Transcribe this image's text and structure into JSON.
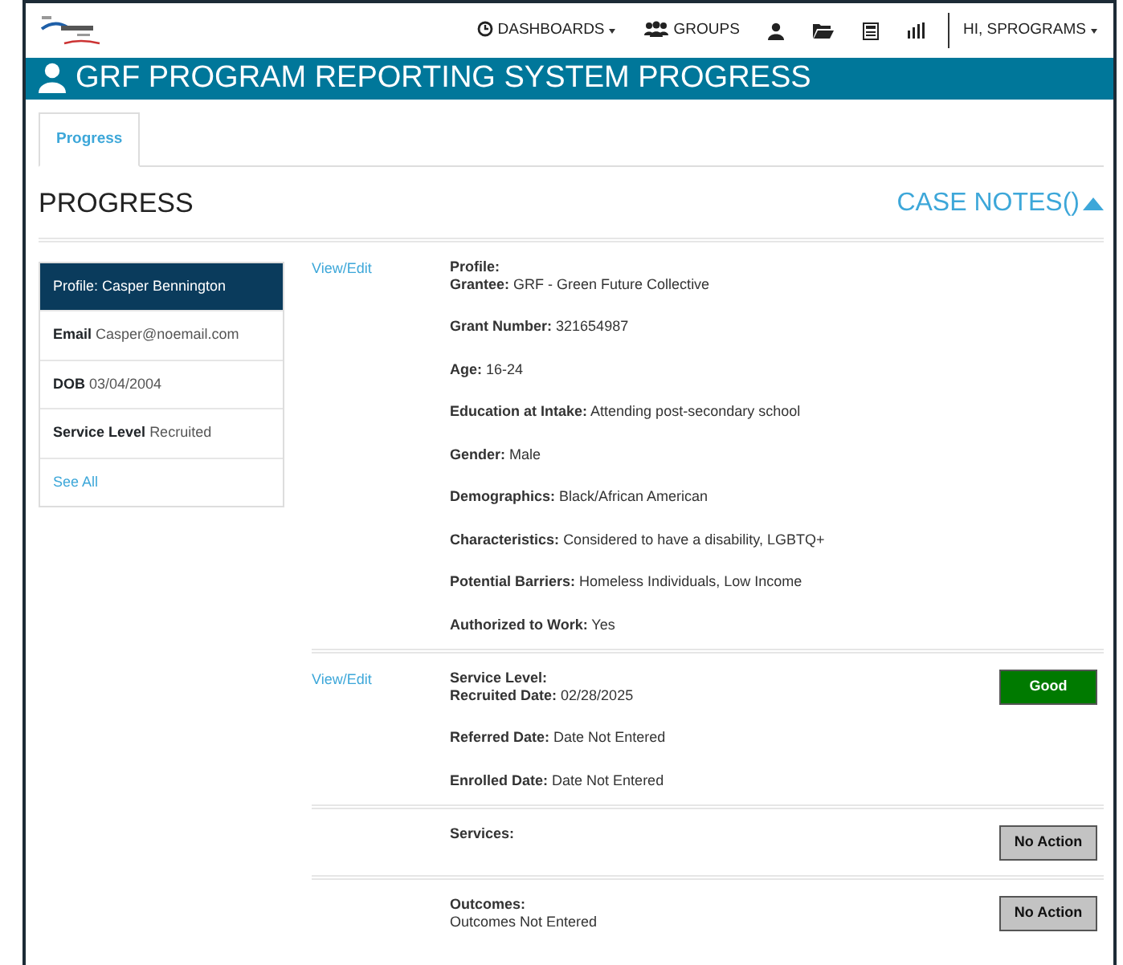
{
  "navbar": {
    "items": [
      {
        "kind": "dashboards",
        "label": "DASHBOARDS",
        "caret": true
      },
      {
        "kind": "groups",
        "label": "GROUPS",
        "caret": false
      },
      {
        "kind": "user",
        "caret": false
      },
      {
        "kind": "folder",
        "caret": false
      },
      {
        "kind": "report",
        "caret": false
      },
      {
        "kind": "chart",
        "caret": false
      }
    ],
    "user_menu": {
      "label": "HI, SPROGRAMS",
      "caret": true
    }
  },
  "banner": {
    "title": "GRF PROGRAM REPORTING SYSTEM PROGRESS"
  },
  "tabs": [
    {
      "label": "Progress",
      "selected": true
    }
  ],
  "page": {
    "title": "PROGRESS",
    "case_notes": "CASE NOTES()",
    "expanded": true
  },
  "sidebar": {
    "header": "Profile: Casper Bennington",
    "items": [
      {
        "label": "Email",
        "value": "Casper@noemail.com"
      },
      {
        "label": "DOB",
        "value": "03/04/2004"
      },
      {
        "label": "Service Level",
        "value": "Recruited"
      }
    ],
    "link": "See All"
  },
  "sections": [
    {
      "link": "View/Edit",
      "heading": "Profile:",
      "fields": [
        {
          "label": "Grantee:",
          "value": "GRF - Green Future Collective"
        },
        {
          "label": "Grant Number:",
          "value": "321654987"
        },
        {
          "label": "Age:",
          "value": "16-24"
        },
        {
          "label": "Education at Intake:",
          "value": "Attending post-secondary school"
        },
        {
          "label": "Gender:",
          "value": "Male"
        },
        {
          "label": "Demographics:",
          "value": "Black/African American"
        },
        {
          "label": "Characteristics:",
          "value": "Considered to have a disability, LGBTQ+"
        },
        {
          "label": "Potential Barriers:",
          "value": "Homeless Individuals, Low Income"
        },
        {
          "label": "Authorized to Work:",
          "value": "Yes"
        }
      ]
    },
    {
      "link": "View/Edit",
      "heading": "Service Level:",
      "status": {
        "label": "Good",
        "kind": "good"
      },
      "fields": [
        {
          "label": "Recruited Date:",
          "value": "02/28/2025"
        },
        {
          "label": "Referred Date:",
          "value": "Date Not Entered"
        },
        {
          "label": "Enrolled Date:",
          "value": "Date Not Entered"
        }
      ]
    },
    {
      "heading": "Services:",
      "status": {
        "label": "No Action",
        "kind": "none"
      }
    },
    {
      "heading": "Outcomes:",
      "note": "Outcomes Not Entered",
      "status": {
        "label": "No Action",
        "kind": "none"
      }
    }
  ]
}
